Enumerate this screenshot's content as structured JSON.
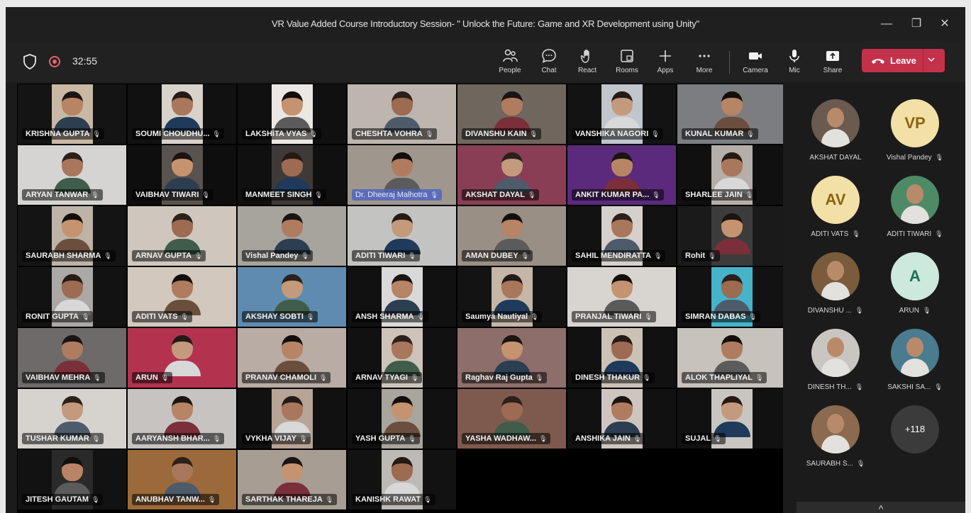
{
  "window": {
    "title": "VR Value Added Course Introductory Session- \" Unlock the Future: Game and XR Development using Unity\"",
    "minimize": "—",
    "restore": "❐",
    "close": "✕"
  },
  "toolbar": {
    "timer": "32:55",
    "buttons": [
      {
        "id": "people",
        "label": "People"
      },
      {
        "id": "chat",
        "label": "Chat"
      },
      {
        "id": "react",
        "label": "React"
      },
      {
        "id": "rooms",
        "label": "Rooms"
      },
      {
        "id": "apps",
        "label": "Apps"
      },
      {
        "id": "more",
        "label": "More"
      },
      {
        "id": "camera",
        "label": "Camera"
      },
      {
        "id": "mic",
        "label": "Mic"
      },
      {
        "id": "share",
        "label": "Share"
      }
    ],
    "leave_label": "Leave",
    "leave_color": "#c4314b"
  },
  "mic_glyph": "🎙",
  "tiles": [
    {
      "name": "KRISHNA GUPTA",
      "bg": "#141414",
      "card": "#c8b8a4"
    },
    {
      "name": "SOUMI CHOUDHU...",
      "bg": "#111111",
      "card": "#d9d2ca"
    },
    {
      "name": "LAKSHITA VYAS",
      "bg": "#101010",
      "card": "#ece7e3"
    },
    {
      "name": "CHESHTA VOHRA",
      "bg": "#bdb5ae"
    },
    {
      "name": "DIVANSHU KAIN",
      "bg": "#6f665e"
    },
    {
      "name": "VANSHIKA NAGORI",
      "bg": "#131313",
      "card": "#c0c6cc"
    },
    {
      "name": "KUNAL KUMAR",
      "bg": "#7c7d80"
    },
    {
      "name": "ARYAN TANWAR",
      "bg": "#d6d4d2"
    },
    {
      "name": "VAIBHAV TIWARI",
      "bg": "#0e0e0e",
      "card": "#595350"
    },
    {
      "name": "MANMEET SINGH",
      "bg": "#101010",
      "card": "#3f3a38"
    },
    {
      "name": "Dr. Dheeraj Malhotra",
      "bg": "#9f978e",
      "blue": true
    },
    {
      "name": "AKSHAT DAYAL",
      "bg": "#8a3e55"
    },
    {
      "name": "ANKIT KUMAR PA...",
      "bg": "#5b2a7c"
    },
    {
      "name": "SHARLEE JAIN",
      "bg": "#101010",
      "card": "#b6aea8"
    },
    {
      "name": "SAURABH SHARMA",
      "bg": "#141414",
      "card": "#bdb3a7"
    },
    {
      "name": "ARNAV GUPTA",
      "bg": "#cfc7bd"
    },
    {
      "name": "Vishal Pandey",
      "bg": "#a7a39d"
    },
    {
      "name": "ADITI TIWARI",
      "bg": "#c3c4c1"
    },
    {
      "name": "AMAN DUBEY",
      "bg": "#9a8f84"
    },
    {
      "name": "SAHIL MENDIRATTA",
      "bg": "#121212",
      "card": "#d5d0cb"
    },
    {
      "name": "Rohit",
      "bg": "#1a1a1a",
      "card": "#3c3c3c"
    },
    {
      "name": "RONIT GUPTA",
      "bg": "#121212",
      "card": "#aba8a5"
    },
    {
      "name": "ADITI VATS",
      "bg": "#d2c8bd"
    },
    {
      "name": "AKSHAY SOBTI",
      "bg": "#5f8bb0"
    },
    {
      "name": "ANSH SHARMA",
      "bg": "#111111",
      "card": "#d9d9d9"
    },
    {
      "name": "Saumya Nautiyal",
      "bg": "#131313",
      "card": "#c5b6a6"
    },
    {
      "name": "PRANJAL TIWARI",
      "bg": "#d8d5d0"
    },
    {
      "name": "SIMRAN DABAS",
      "bg": "#121212",
      "card": "#45b4c9"
    },
    {
      "name": "VAIBHAV MEHRA",
      "bg": "#6e6a6a"
    },
    {
      "name": "ARUN",
      "bg": "#b3334f"
    },
    {
      "name": "PRANAV CHAMOLI",
      "bg": "#b8aca4"
    },
    {
      "name": "ARNAV TYAGI",
      "bg": "#111111",
      "card": "#cdc3b9"
    },
    {
      "name": "Raghav Raj Gupta",
      "bg": "#8e6e6a"
    },
    {
      "name": "DINESH THAKUR",
      "bg": "#111111",
      "card": "#cbc1b4"
    },
    {
      "name": "ALOK THAPLIYAL",
      "bg": "#c7c2bc"
    },
    {
      "name": "TUSHAR KUMAR",
      "bg": "#d6d3cf"
    },
    {
      "name": "AARYANSH BHAR...",
      "bg": "#c6c3c0"
    },
    {
      "name": "VYKHA VIJAY",
      "bg": "#111111",
      "card": "#b7a497"
    },
    {
      "name": "YASH GUPTA",
      "bg": "#111111",
      "card": "#a8a59d"
    },
    {
      "name": "YASHA WADHAW...",
      "bg": "#7d5a4d"
    },
    {
      "name": "ANSHIKA JAIN",
      "bg": "#111111",
      "card": "#cfc5c0"
    },
    {
      "name": "SUJAL",
      "bg": "#111111",
      "card": "#c9c6c2"
    },
    {
      "name": "JITESH GAUTAM",
      "bg": "#121212",
      "card": "#2a2a2a"
    },
    {
      "name": "ANUBHAV TANW...",
      "bg": "#9c6a3a"
    },
    {
      "name": "SARTHAK THAREJA",
      "bg": "#a79d93"
    },
    {
      "name": "KANISHK RAWAT",
      "bg": "#121212",
      "card": "#bdbab6"
    }
  ],
  "roster": [
    {
      "name": "AKSHAT DAYAL",
      "photo": "#6a5a4f"
    },
    {
      "name": "Vishal Pandey",
      "initials": "VP",
      "av_bg": "#f3e0a6",
      "av_fg": "#8a6412"
    },
    {
      "name": "ADITI VATS",
      "initials": "AV",
      "av_bg": "#f3e0a6",
      "av_fg": "#8a6412"
    },
    {
      "name": "ADITI TIWARI",
      "photo": "#4f8a66"
    },
    {
      "name": "DIVANSHU ...",
      "photo": "#7a5b3c"
    },
    {
      "name": "ARUN",
      "initials": "A",
      "av_bg": "#cde8dd",
      "av_fg": "#1f6f57"
    },
    {
      "name": "DINESH TH...",
      "photo": "#c9c6c1"
    },
    {
      "name": "SAKSHI SA...",
      "photo": "#4a7b8f"
    },
    {
      "name": "SAURABH S...",
      "photo": "#8b6a4f"
    },
    {
      "name": "+118",
      "more": true
    }
  ],
  "expand_glyph": "^"
}
